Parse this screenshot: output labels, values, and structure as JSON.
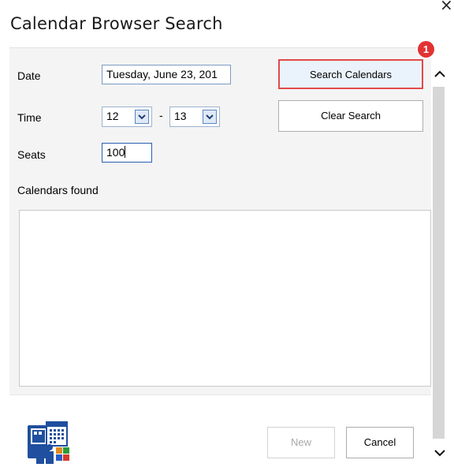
{
  "window": {
    "title": "Calendar Browser Search",
    "close_glyph": "×"
  },
  "form": {
    "date_label": "Date",
    "date_value": "Tuesday, June 23, 201",
    "time_label": "Time",
    "time_from": "12",
    "time_separator": "-",
    "time_to": "13",
    "seats_label": "Seats",
    "seats_value": "100",
    "calendars_found_label": "Calendars found"
  },
  "buttons": {
    "search": "Search Calendars",
    "clear": "Clear Search",
    "new": "New",
    "cancel": "Cancel"
  },
  "annotation": {
    "step_number": "1",
    "color": "#e33232"
  },
  "icons": {
    "dropdown": "chevron-down-icon",
    "scroll_up": "chevron-up-icon",
    "scroll_down": "chevron-down-icon",
    "logo": "calendar-people-logo"
  }
}
